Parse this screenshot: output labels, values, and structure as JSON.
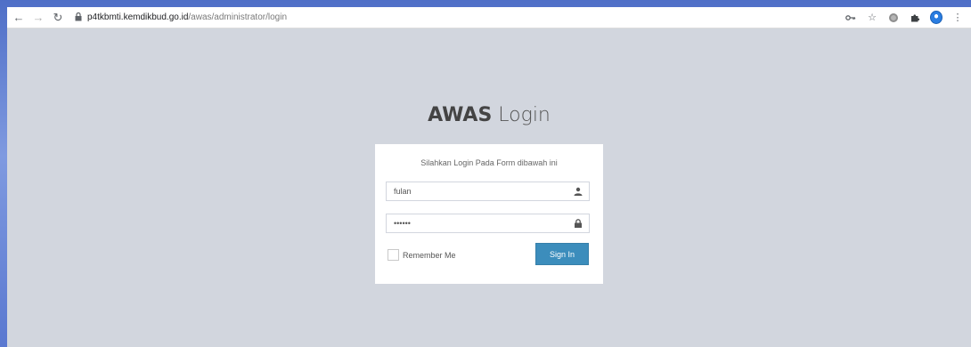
{
  "browser": {
    "url_host": "p4tkbmti.kemdikbud.go.id",
    "url_path": "/awas/administrator/login",
    "icons": [
      "back-icon",
      "forward-icon",
      "reload-icon",
      "lock-icon",
      "key-icon",
      "star-icon",
      "extension-icon",
      "puzzle-icon",
      "profile-avatar",
      "menu-icon"
    ]
  },
  "login": {
    "brand": "AWAS",
    "title_rest": " Login",
    "message": "Silahkan Login Pada Form dibawah ini",
    "username_value": "fulan",
    "password_value": "••••••",
    "remember_label": "Remember Me",
    "signin_label": "Sign In"
  },
  "colors": {
    "page_bg": "#d2d6de",
    "button": "#3c8dbc"
  }
}
